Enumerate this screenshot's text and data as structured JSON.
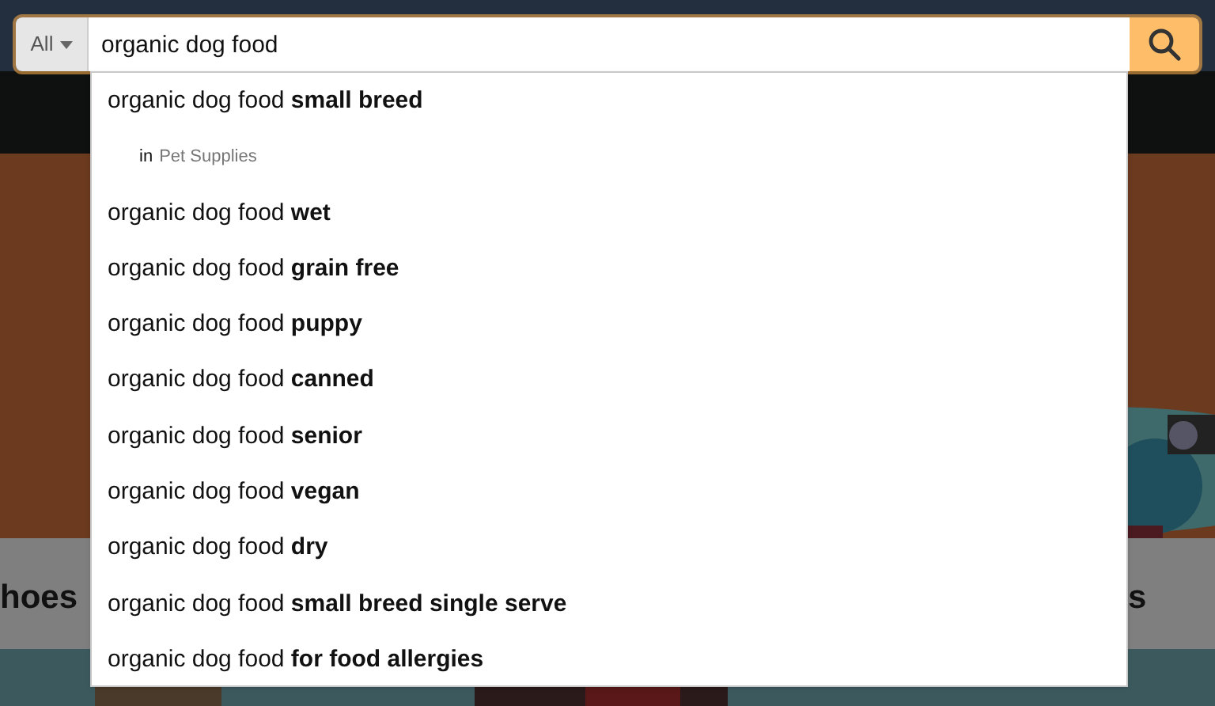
{
  "search": {
    "category": "All",
    "value": "organic dog food"
  },
  "suggestions": [
    {
      "kind": "query",
      "text": "organic dog food **small breed**"
    },
    {
      "kind": "department",
      "prefix": "in",
      "department": "Pet Supplies"
    },
    {
      "kind": "query",
      "text": "organic dog food **wet**"
    },
    {
      "kind": "query",
      "text": "organic dog food **grain free**"
    },
    {
      "kind": "query",
      "text": "organic dog food **puppy**"
    },
    {
      "kind": "query",
      "text": "organic dog food **canned**"
    },
    {
      "kind": "query",
      "text": "organic dog food **senior**"
    },
    {
      "kind": "query",
      "text": "organic dog food **vegan**"
    },
    {
      "kind": "query",
      "text": "organic dog food **dry**"
    },
    {
      "kind": "query",
      "text": "organic dog food **small breed single serve**"
    },
    {
      "kind": "query",
      "text": "organic dog food **for food allergies**"
    }
  ],
  "background_cards": [
    "hoes",
    "s"
  ]
}
